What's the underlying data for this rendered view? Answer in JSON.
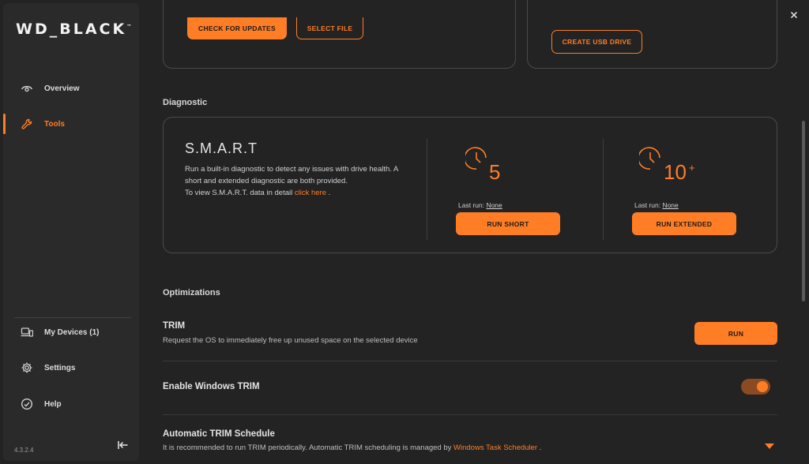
{
  "app": {
    "logo": "WD_BLACK",
    "logo_tm": "™",
    "version": "4.3.2.4"
  },
  "sidebar": {
    "items": [
      {
        "label": "Overview",
        "icon": "eye-icon"
      },
      {
        "label": "Tools",
        "icon": "wrench-icon",
        "active": true
      },
      {
        "label": "My Devices (1)",
        "icon": "devices-icon"
      },
      {
        "label": "Settings",
        "icon": "gear-icon"
      },
      {
        "label": "Help",
        "icon": "help-icon"
      }
    ],
    "collapse_icon": "collapse-left-icon"
  },
  "window_controls": [
    "minimize-icon",
    "maximize-icon",
    "close-icon"
  ],
  "top_cards": {
    "check_updates_label": "CHECK FOR UPDATES",
    "select_file_label": "SELECT FILE",
    "create_usb_label": "CREATE USB DRIVE"
  },
  "diagnostic": {
    "section_title": "Diagnostic",
    "smart_title": "S.M.A.R.T",
    "smart_desc_1": "Run a built-in diagnostic to detect any issues with drive health. A short and extended diagnostic are both provided.",
    "smart_desc_2": "To view S.M.A.R.T. data in detail ",
    "smart_link": "click here",
    "smart_desc_3": " .",
    "short": {
      "minutes": "5",
      "lastrun_label": "Last run: ",
      "lastrun_value": "None",
      "button": "RUN SHORT"
    },
    "extended": {
      "minutes": "10",
      "minutes_sup": "+",
      "lastrun_label": "Last run: ",
      "lastrun_value": "None",
      "button": "RUN EXTENDED"
    }
  },
  "optimizations": {
    "section_title": "Optimizations",
    "trim_title": "TRIM",
    "trim_desc": "Request the OS to immediately free up unused space on the selected device",
    "trim_button": "RUN",
    "windows_trim_title": "Enable Windows TRIM",
    "windows_trim_enabled": true,
    "schedule_title": "Automatic TRIM Schedule",
    "schedule_desc": "It is recommended to run TRIM periodically. Automatic TRIM scheduling is managed by ",
    "schedule_link": "Windows Task Scheduler",
    "schedule_desc_end": " ."
  },
  "colors": {
    "accent": "#ff7d25",
    "background": "#232323",
    "sidebar": "#2a2a2a"
  }
}
